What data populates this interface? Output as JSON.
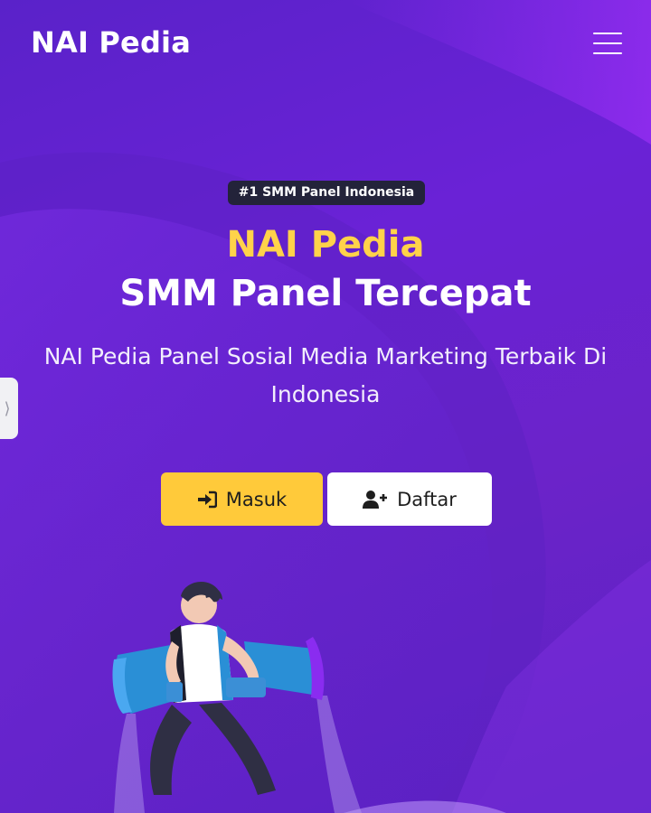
{
  "navbar": {
    "brand": "NAI Pedia",
    "menu_icon": "hamburger-menu-icon"
  },
  "side_tab": {
    "icon": "chevron-right-icon",
    "glyph": "⟩"
  },
  "hero": {
    "badge": "#1 SMM Panel Indonesia",
    "title_line1": "NAI Pedia",
    "title_line2": "SMM Panel Tercepat",
    "subtitle": "NAI Pedia Panel Sosial Media Marketing Terbaik Di Indonesia"
  },
  "buttons": {
    "login_label": "Masuk",
    "login_icon": "sign-in-icon",
    "register_label": "Daftar",
    "register_icon": "user-plus-icon"
  },
  "colors": {
    "background": "#6a22d6",
    "accent_yellow": "#ffca3a",
    "title_yellow": "#ffd24a",
    "badge_bg": "#23233a"
  }
}
